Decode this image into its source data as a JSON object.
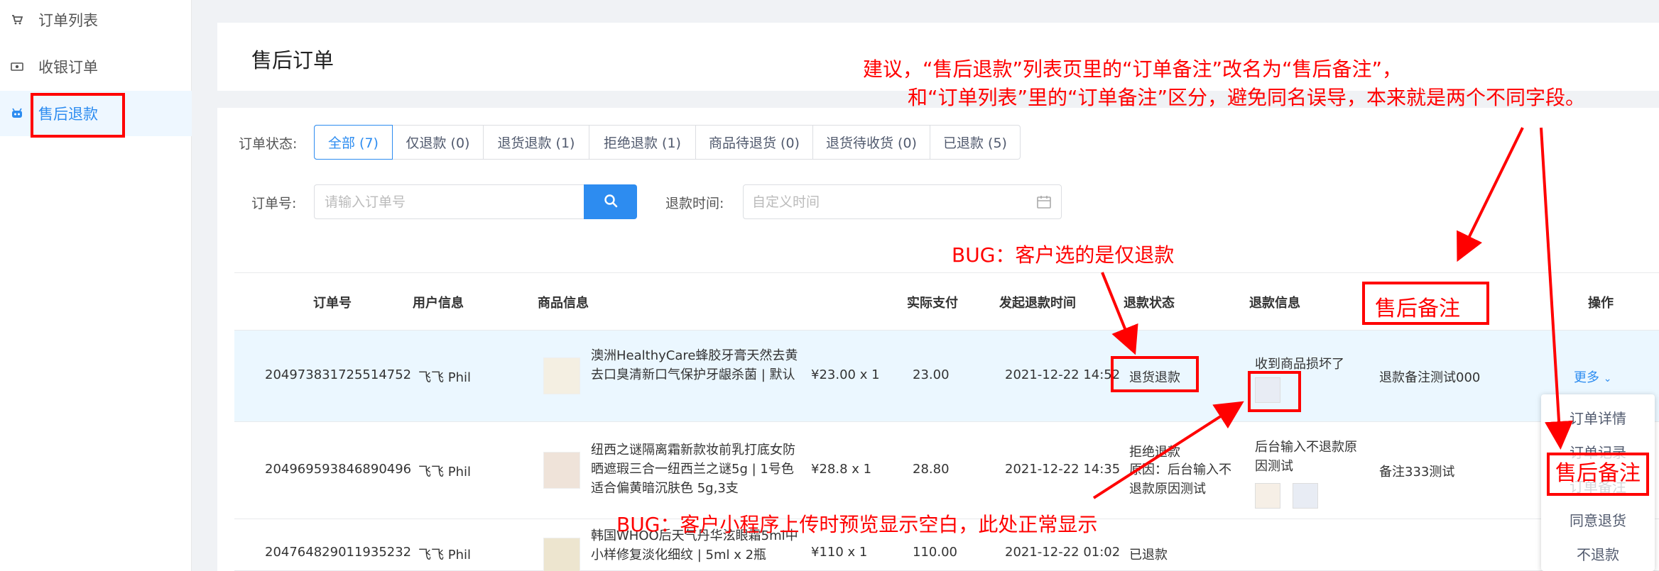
{
  "sidebar": {
    "items": [
      {
        "label": "订单列表",
        "icon": "cart-icon"
      },
      {
        "label": "收银订单",
        "icon": "cash-icon"
      },
      {
        "label": "售后退款",
        "icon": "robot-icon",
        "active": true
      }
    ]
  },
  "header": {
    "title": "售后订单"
  },
  "filters": {
    "status_label": "订单状态:",
    "tabs": [
      {
        "label": "全部 (7)",
        "active": true
      },
      {
        "label": "仅退款 (0)"
      },
      {
        "label": "退货退款 (1)"
      },
      {
        "label": "拒绝退款 (1)"
      },
      {
        "label": "商品待退货 (0)"
      },
      {
        "label": "退货待收货 (0)"
      },
      {
        "label": "已退款 (5)"
      }
    ],
    "order_label": "订单号:",
    "order_placeholder": "请输入订单号",
    "refund_time_label": "退款时间:",
    "date_placeholder": "自定义时间"
  },
  "table": {
    "columns": [
      "订单号",
      "用户信息",
      "商品信息",
      "实际支付",
      "发起退款时间",
      "退款状态",
      "退款信息",
      "备注",
      "操作"
    ],
    "rows": [
      {
        "order_no": "204973831725514752",
        "user": "飞飞 Phil",
        "product": "澳洲HealthyCare蜂胶牙膏天然去黄去口臭清新口气保护牙龈杀菌 | 默认",
        "price_qty": "¥23.00 x 1",
        "paid": "23.00",
        "time": "2021-12-22 14:52",
        "status": "退货退款",
        "refund_info": "收到商品损坏了",
        "remark": "退款备注测试000",
        "action": "更多"
      },
      {
        "order_no": "204969593846890496",
        "user": "飞飞 Phil",
        "product": "纽西之谜隔离霜新款妆前乳打底女防晒遮瑕三合一纽西兰之谜5g | 1号色适合偏黄暗沉肤色 5g,3支",
        "price_qty": "¥28.8 x 1",
        "paid": "28.80",
        "time": "2021-12-22 14:35",
        "status": "拒绝退款",
        "status_reason": "原因：后台输入不退款原因测试",
        "refund_info": "后台输入不退款原因测试",
        "remark": "备注333测试"
      },
      {
        "order_no": "204764829011935232",
        "user": "飞飞 Phil",
        "product": "韩国WHOO后天气丹华泫眼霜5ml中小样修复淡化细纹 | 5ml x 2瓶",
        "price_qty": "¥110 x 1",
        "paid": "110.00",
        "time": "2021-12-22 01:02",
        "status": "已退款"
      }
    ]
  },
  "dropdown": {
    "items": [
      "订单详情",
      "订单记录",
      "订单备注",
      "同意退货",
      "不退款"
    ]
  },
  "annotations": {
    "suggestion_line1": "建议，“售后退款”列表页里的“订单备注”改名为“售后备注”，",
    "suggestion_line2": "和“订单列表”里的“订单备注”区分，避免同名误导，本来就是两个不同字段。",
    "bug1": "BUG：客户选的是仅退款",
    "bug2": "BUG：客户小程序上传时预览显示空白，此处正常显示",
    "header_rename": "售后备注",
    "menu_rename": "售后备注"
  }
}
